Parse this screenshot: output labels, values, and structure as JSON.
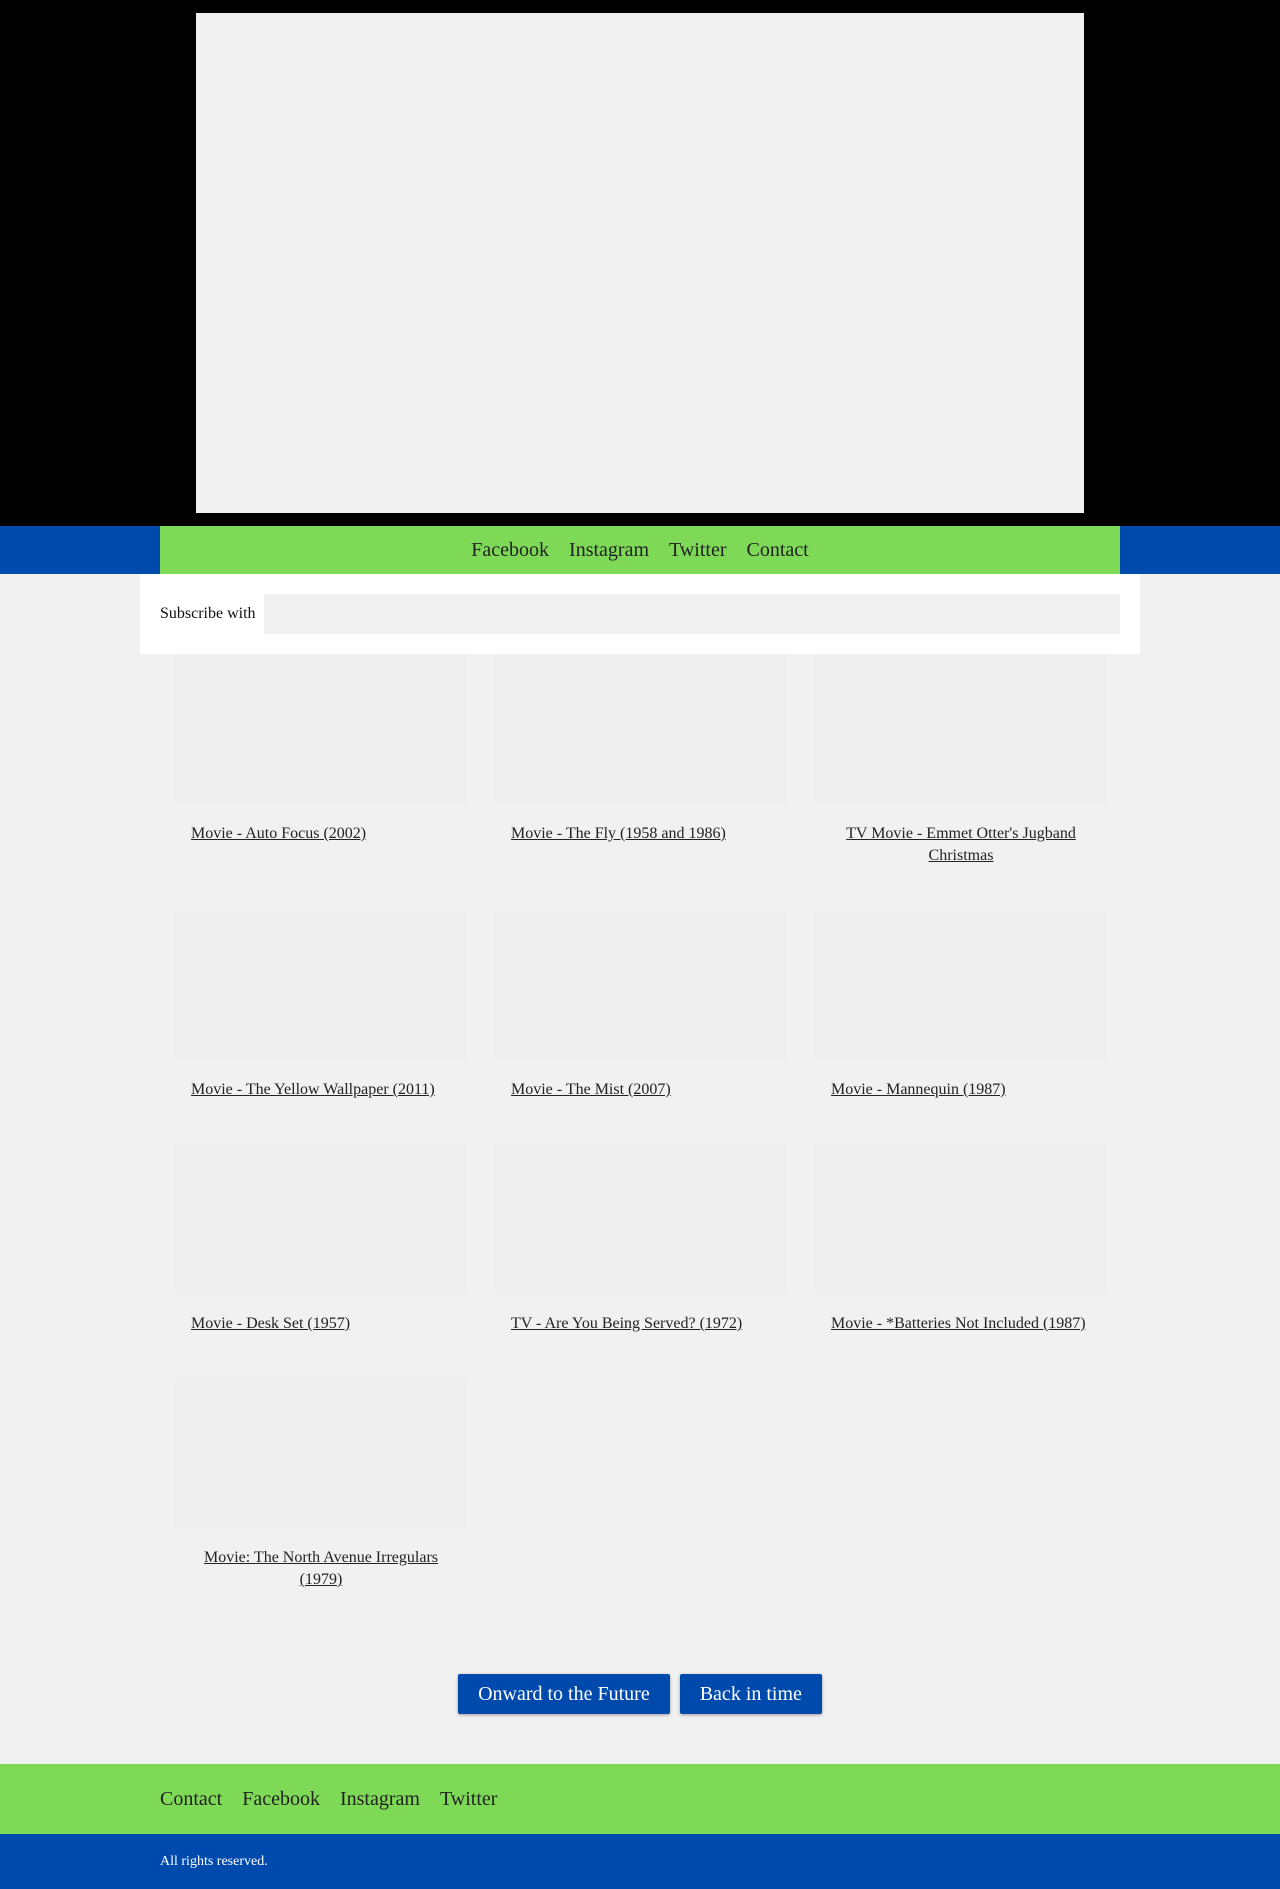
{
  "nav": {
    "items": [
      "Facebook",
      "Instagram",
      "Twitter",
      "Contact"
    ]
  },
  "subscribe": {
    "label": "Subscribe with",
    "value": "",
    "placeholder": ""
  },
  "cards": [
    "Movie - Auto Focus (2002)",
    "Movie - The Fly (1958 and 1986)",
    "TV Movie - Emmet Otter's Jugband Christmas",
    "Movie - The Yellow Wallpaper (2011)",
    "Movie - The Mist (2007)",
    "Movie - Mannequin (1987)",
    "Movie - Desk Set (1957)",
    "TV - Are You Being Served? (1972)",
    "Movie - *Batteries Not Included (1987)",
    "Movie: The North Avenue Irregulars (1979)"
  ],
  "pager": {
    "next_label": "Onward to the Future",
    "prev_label": "Back in time"
  },
  "footer": {
    "nav_items": [
      "Contact",
      "Facebook",
      "Instagram",
      "Twitter"
    ],
    "copyright": "All rights reserved."
  },
  "colors": {
    "blue": "#004aad",
    "green": "#7ed957",
    "hero_bg": "#000000",
    "page_bg": "#f1f1f1"
  }
}
